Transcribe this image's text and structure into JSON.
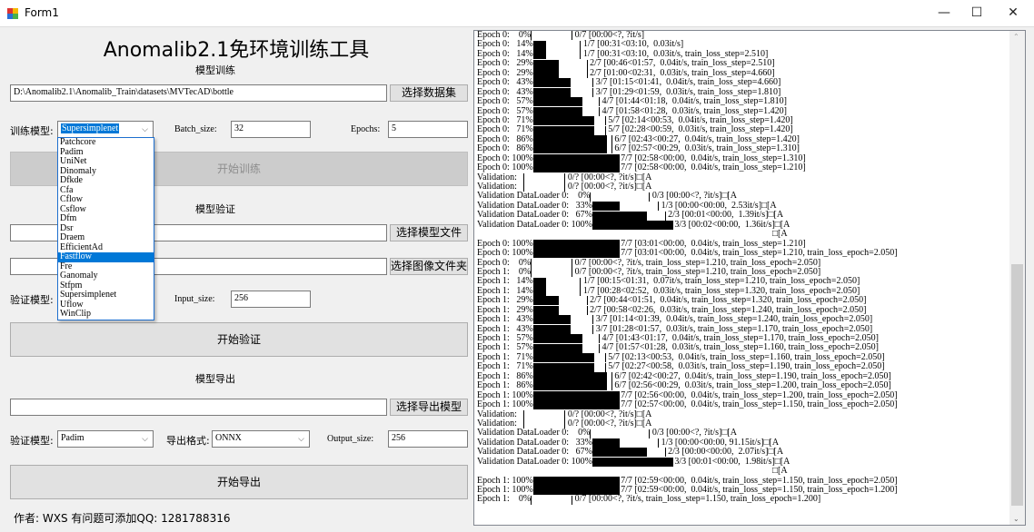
{
  "window": {
    "title": "Form1",
    "minimize": "—",
    "maximize": "☐",
    "close": "✕"
  },
  "header": {
    "title": "Anomalib2.1免环境训练工具"
  },
  "train": {
    "section": "模型训练",
    "dataset_path": "D:\\Anomalib2.1\\Anomalib_Train\\datasets\\MVTecAD\\bottle",
    "select_dataset": "选择数据集",
    "model_label": "训练模型:",
    "model_value": "Supersimplenet",
    "batch_label": "Batch_size:",
    "batch_value": "32",
    "epochs_label": "Epochs:",
    "epochs_value": "5",
    "start": "开始训练",
    "model_options": [
      "Patchcore",
      "Padim",
      "UniNet",
      "Dinomaly",
      "Dfkde",
      "Cfa",
      "Cflow",
      "Csflow",
      "Dfm",
      "Dsr",
      "Draem",
      "EfficientAd",
      "Fastflow",
      "Fre",
      "Ganomaly",
      "Stfpm",
      "Supersimplenet",
      "Uflow",
      "WinClip"
    ],
    "highlighted": "Fastflow"
  },
  "validate": {
    "section": "模型验证",
    "model_path": "",
    "select_model": "选择模型文件",
    "image_path": "",
    "select_images": "选择图像文件夹",
    "model_label": "验证模型:",
    "input_label": "Input_size:",
    "input_value": "256",
    "start": "开始验证"
  },
  "export": {
    "section": "模型导出",
    "path": "",
    "select_export": "选择导出模型",
    "model_label": "验证模型:",
    "model_value": "Padim",
    "format_label": "导出格式:",
    "format_value": "ONNX",
    "output_label": "Output_size:",
    "output_value": "256",
    "start": "开始导出"
  },
  "footer": {
    "text": "作者: WXS  有问题可添加QQ: 1281788316"
  },
  "console": [
    {
      "p": "Epoch 0:    0%",
      "f": 0,
      "r": " 0/7 [00:00<?, ?it/s]"
    },
    {
      "p": "Epoch 0:   14%",
      "f": 0.14,
      "r": " 1/7 [00:31<03:10,  0.03it/s]"
    },
    {
      "p": "Epoch 0:   14%",
      "f": 0.14,
      "r": " 1/7 [00:31<03:10,  0.03it/s, train_loss_step=2.510]"
    },
    {
      "p": "Epoch 0:   29%",
      "f": 0.29,
      "r": " 2/7 [00:46<01:57,  0.04it/s, train_loss_step=2.510]"
    },
    {
      "p": "Epoch 0:   29%",
      "f": 0.29,
      "r": " 2/7 [01:00<02:31,  0.03it/s, train_loss_step=4.660]"
    },
    {
      "p": "Epoch 0:   43%",
      "f": 0.43,
      "r": " 3/7 [01:15<01:41,  0.04it/s, train_loss_step=4.660]"
    },
    {
      "p": "Epoch 0:   43%",
      "f": 0.43,
      "r": " 3/7 [01:29<01:59,  0.03it/s, train_loss_step=1.810]"
    },
    {
      "p": "Epoch 0:   57%",
      "f": 0.57,
      "r": " 4/7 [01:44<01:18,  0.04it/s, train_loss_step=1.810]"
    },
    {
      "p": "Epoch 0:   57%",
      "f": 0.57,
      "r": " 4/7 [01:58<01:28,  0.03it/s, train_loss_step=1.420]"
    },
    {
      "p": "Epoch 0:   71%",
      "f": 0.71,
      "r": " 5/7 [02:14<00:53,  0.04it/s, train_loss_step=1.420]"
    },
    {
      "p": "Epoch 0:   71%",
      "f": 0.71,
      "r": " 5/7 [02:28<00:59,  0.03it/s, train_loss_step=1.420]"
    },
    {
      "p": "Epoch 0:   86%",
      "f": 0.86,
      "r": " 6/7 [02:43<00:27,  0.04it/s, train_loss_step=1.420]"
    },
    {
      "p": "Epoch 0:   86%",
      "f": 0.86,
      "r": " 6/7 [02:57<00:29,  0.03it/s, train_loss_step=1.310]"
    },
    {
      "p": "Epoch 0: 100%",
      "f": 1,
      "r": " 7/7 [02:58<00:00,  0.04it/s, train_loss_step=1.310]"
    },
    {
      "p": "Epoch 0: 100%",
      "f": 1,
      "r": " 7/7 [02:58<00:00,  0.04it/s, train_loss_step=1.210]"
    },
    {
      "p": "Validation:   ",
      "f": 0,
      "r": " 0/? [00:00<?, ?it/s]□[A"
    },
    {
      "p": "Validation:   ",
      "f": 0,
      "r": " 0/? [00:00<?, ?it/s]□[A"
    },
    {
      "p": "Validation DataLoader 0:    0%",
      "f": 0,
      "r": " 0/3 [00:00<?, ?it/s]□[A"
    },
    {
      "p": "Validation DataLoader 0:   33%",
      "f": 0.33,
      "r": " 1/3 [00:00<00:00,  2.53it/s]□[A"
    },
    {
      "p": "Validation DataLoader 0:   67%",
      "f": 0.67,
      "r": " 2/3 [00:01<00:00,  1.39it/s]□[A"
    },
    {
      "p": "Validation DataLoader 0: 100%",
      "f": 1,
      "r": " 3/3 [00:02<00:00,  1.36it/s]□[A"
    },
    {
      "t": "                                                                                                                                  □[A"
    },
    {
      "p": "Epoch 0: 100%",
      "f": 1,
      "r": " 7/7 [03:01<00:00,  0.04it/s, train_loss_step=1.210]"
    },
    {
      "p": "Epoch 0: 100%",
      "f": 1,
      "r": " 7/7 [03:01<00:00,  0.04it/s, train_loss_step=1.210, train_loss_epoch=2.050]"
    },
    {
      "p": "Epoch 0:    0%",
      "f": 0,
      "r": " 0/7 [00:00<?, ?it/s, train_loss_step=1.210, train_loss_epoch=2.050]"
    },
    {
      "p": "Epoch 1:    0%",
      "f": 0,
      "r": " 0/7 [00:00<?, ?it/s, train_loss_step=1.210, train_loss_epoch=2.050]"
    },
    {
      "p": "Epoch 1:   14%",
      "f": 0.14,
      "r": " 1/7 [00:15<01:31,  0.07it/s, train_loss_step=1.210, train_loss_epoch=2.050]"
    },
    {
      "p": "Epoch 1:   14%",
      "f": 0.14,
      "r": " 1/7 [00:28<02:52,  0.03it/s, train_loss_step=1.320, train_loss_epoch=2.050]"
    },
    {
      "p": "Epoch 1:   29%",
      "f": 0.29,
      "r": " 2/7 [00:44<01:51,  0.04it/s, train_loss_step=1.320, train_loss_epoch=2.050]"
    },
    {
      "p": "Epoch 1:   29%",
      "f": 0.29,
      "r": " 2/7 [00:58<02:26,  0.03it/s, train_loss_step=1.240, train_loss_epoch=2.050]"
    },
    {
      "p": "Epoch 1:   43%",
      "f": 0.43,
      "r": " 3/7 [01:14<01:39,  0.04it/s, train_loss_step=1.240, train_loss_epoch=2.050]"
    },
    {
      "p": "Epoch 1:   43%",
      "f": 0.43,
      "r": " 3/7 [01:28<01:57,  0.03it/s, train_loss_step=1.170, train_loss_epoch=2.050]"
    },
    {
      "p": "Epoch 1:   57%",
      "f": 0.57,
      "r": " 4/7 [01:43<01:17,  0.04it/s, train_loss_step=1.170, train_loss_epoch=2.050]"
    },
    {
      "p": "Epoch 1:   57%",
      "f": 0.57,
      "r": " 4/7 [01:57<01:28,  0.03it/s, train_loss_step=1.160, train_loss_epoch=2.050]"
    },
    {
      "p": "Epoch 1:   71%",
      "f": 0.71,
      "r": " 5/7 [02:13<00:53,  0.04it/s, train_loss_step=1.160, train_loss_epoch=2.050]"
    },
    {
      "p": "Epoch 1:   71%",
      "f": 0.71,
      "r": " 5/7 [02:27<00:58,  0.03it/s, train_loss_step=1.190, train_loss_epoch=2.050]"
    },
    {
      "p": "Epoch 1:   86%",
      "f": 0.86,
      "r": " 6/7 [02:42<00:27,  0.04it/s, train_loss_step=1.190, train_loss_epoch=2.050]"
    },
    {
      "p": "Epoch 1:   86%",
      "f": 0.86,
      "r": " 6/7 [02:56<00:29,  0.03it/s, train_loss_step=1.200, train_loss_epoch=2.050]"
    },
    {
      "p": "Epoch 1: 100%",
      "f": 1,
      "r": " 7/7 [02:56<00:00,  0.04it/s, train_loss_step=1.200, train_loss_epoch=2.050]"
    },
    {
      "p": "Epoch 1: 100%",
      "f": 1,
      "r": " 7/7 [02:57<00:00,  0.04it/s, train_loss_step=1.150, train_loss_epoch=2.050]"
    },
    {
      "p": "Validation:   ",
      "f": 0,
      "r": " 0/? [00:00<?, ?it/s]□[A"
    },
    {
      "p": "Validation:   ",
      "f": 0,
      "r": " 0/? [00:00<?, ?it/s]□[A"
    },
    {
      "p": "Validation DataLoader 0:    0%",
      "f": 0,
      "r": " 0/3 [00:00<?, ?it/s]□[A"
    },
    {
      "p": "Validation DataLoader 0:   33%",
      "f": 0.33,
      "r": " 1/3 [00:00<00:00, 91.15it/s]□[A"
    },
    {
      "p": "Validation DataLoader 0:   67%",
      "f": 0.67,
      "r": " 2/3 [00:00<00:00,  2.07it/s]□[A"
    },
    {
      "p": "Validation DataLoader 0: 100%",
      "f": 1,
      "r": " 3/3 [00:01<00:00,  1.98it/s]□[A"
    },
    {
      "t": "                                                                                                                                  □[A"
    },
    {
      "p": "Epoch 1: 100%",
      "f": 1,
      "r": " 7/7 [02:59<00:00,  0.04it/s, train_loss_step=1.150, train_loss_epoch=2.050]"
    },
    {
      "p": "Epoch 1: 100%",
      "f": 1,
      "r": " 7/7 [02:59<00:00,  0.04it/s, train_loss_step=1.150, train_loss_epoch=1.200]"
    },
    {
      "p": "Epoch 1:    0%",
      "f": 0,
      "r": " 0/7 [00:00<?, ?it/s, train_loss_step=1.150, train_loss_epoch=1.200]"
    }
  ]
}
